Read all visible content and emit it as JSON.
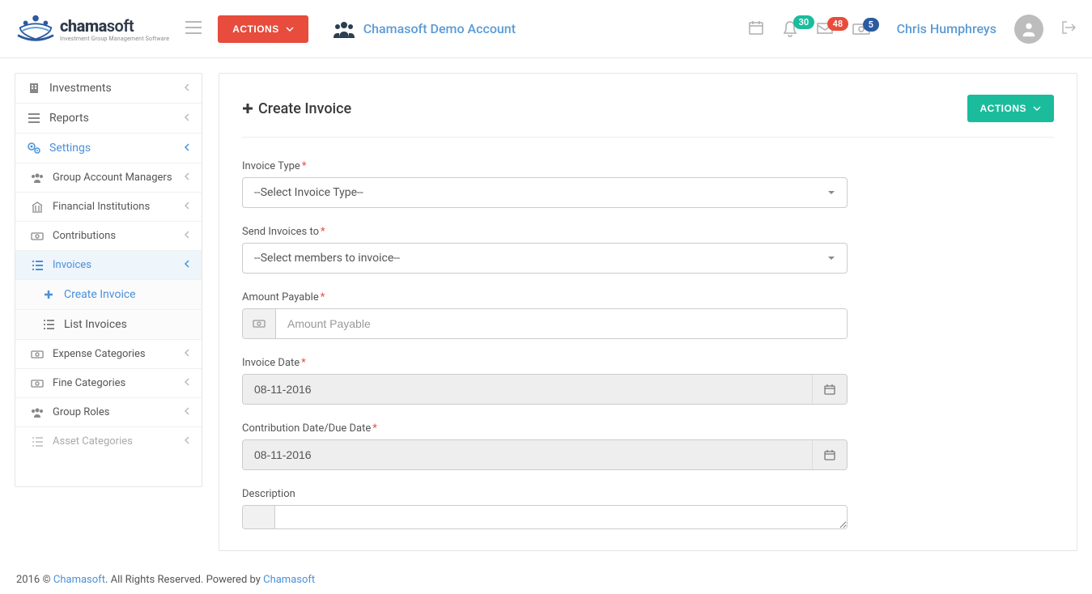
{
  "header": {
    "logo_main_prefix": "chama",
    "logo_main_suffix": "soft",
    "logo_sub": "Investment Group Management Software",
    "actions_btn": "ACTIONS",
    "account_name": "Chamasoft Demo Account",
    "badges": {
      "notifications": "30",
      "messages": "48",
      "money": "5"
    },
    "username": "Chris Humphreys"
  },
  "sidebar": {
    "investments": "Investments",
    "reports": "Reports",
    "settings": "Settings",
    "group_managers": "Group Account Managers",
    "financial_institutions": "Financial Institutions",
    "contributions": "Contributions",
    "invoices": "Invoices",
    "create_invoice": "Create Invoice",
    "list_invoices": "List Invoices",
    "expense_categories": "Expense Categories",
    "fine_categories": "Fine Categories",
    "group_roles": "Group Roles",
    "asset_categories": "Asset Categories"
  },
  "content": {
    "page_title": "Create Invoice",
    "actions_btn": "ACTIONS",
    "form": {
      "invoice_type_label": "Invoice Type",
      "invoice_type_placeholder": "--Select Invoice Type--",
      "send_to_label": "Send Invoices to",
      "send_to_placeholder": "--Select members to invoice--",
      "amount_label": "Amount Payable",
      "amount_placeholder": "Amount Payable",
      "invoice_date_label": "Invoice Date",
      "invoice_date_value": "08-11-2016",
      "due_date_label": "Contribution Date/Due Date",
      "due_date_value": "08-11-2016",
      "description_label": "Description"
    }
  },
  "footer": {
    "copyright_prefix": "2016 © ",
    "company": "Chamasoft",
    "rights": ". All Rights Reserved. Powered by ",
    "powered_by": "Chamasoft"
  }
}
